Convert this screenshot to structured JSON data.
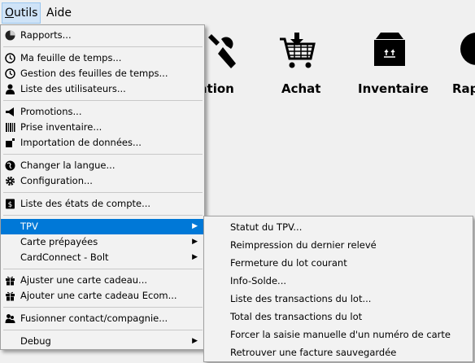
{
  "menubar": {
    "items": [
      {
        "label_ul": "O",
        "label_rest": "utils"
      },
      {
        "label_ul": "",
        "label_rest": "Aide"
      }
    ]
  },
  "toolbar": {
    "items": [
      {
        "label": "ration",
        "icon": "wrench-icon"
      },
      {
        "label": "Achat",
        "icon": "shopping-cart-icon"
      },
      {
        "label": "Inventaire",
        "icon": "box-icon"
      },
      {
        "label": "Rap",
        "icon": "reports-icon"
      }
    ]
  },
  "outils_menu": {
    "items": [
      {
        "label": "Rapports...",
        "icon": "pie-chart-icon"
      },
      {
        "label": "Ma feuille de temps...",
        "icon": "clock-icon"
      },
      {
        "label": "Gestion des feuilles de temps...",
        "icon": "clock-icon"
      },
      {
        "label": "Liste des utilisateurs...",
        "icon": "user-icon"
      },
      {
        "label": "Promotions...",
        "icon": "megaphone-icon"
      },
      {
        "label": "Prise inventaire...",
        "icon": "barcode-icon"
      },
      {
        "label": "Importation de données...",
        "icon": "import-icon"
      },
      {
        "label": "Changer la langue...",
        "icon": "globe-icon"
      },
      {
        "label": "Configuration...",
        "icon": "gear-icon"
      },
      {
        "label": "Liste des états de compte...",
        "icon": "dollar-icon"
      },
      {
        "label": "TPV"
      },
      {
        "label": "Carte prépayées"
      },
      {
        "label": "CardConnect - Bolt"
      },
      {
        "label": "Ajuster une carte cadeau...",
        "icon": "gift-icon"
      },
      {
        "label": "Ajouter une carte cadeau Ecom...",
        "icon": "gift-icon"
      },
      {
        "label": "Fusionner contact/compagnie...",
        "icon": "users-icon"
      },
      {
        "label": "Debug"
      }
    ]
  },
  "tpv_submenu": {
    "items": [
      "Statut du TPV...",
      "Reimpression du dernier relevé",
      "Fermeture du lot courant",
      "Info-Solde...",
      "Liste des transactions du lot...",
      "Total des transactions du lot",
      "Forcer la saisie manuelle d'un numéro de carte",
      "Retrouver une facture sauvegardée"
    ]
  }
}
